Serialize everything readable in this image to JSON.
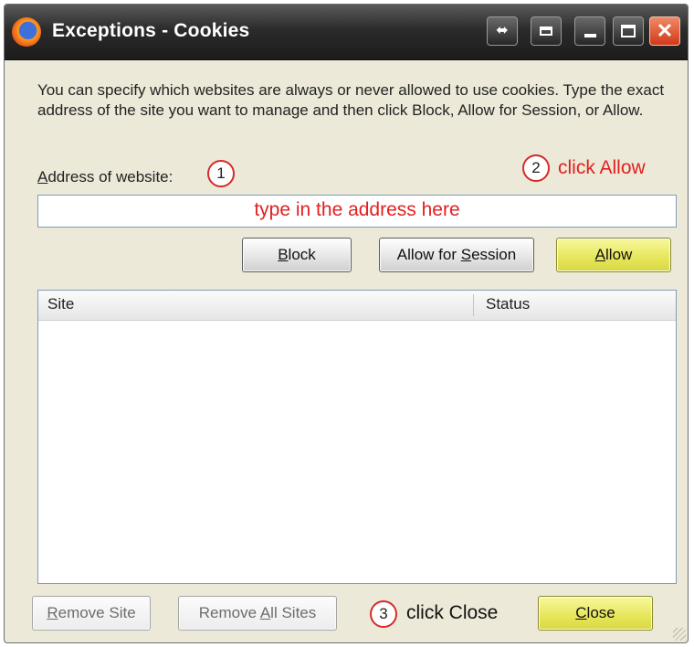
{
  "window": {
    "title": "Exceptions - Cookies",
    "controls": {
      "restore": "⬌",
      "close": "✕"
    }
  },
  "description": "You can specify which websites are always or never allowed to use cookies. Type the exact address of the site you want to manage and then click Block, Allow for Session, or Allow.",
  "address": {
    "label_access_key": "A",
    "label_rest": "ddress of website:",
    "value": "",
    "placeholder_annotation": "type in the address here"
  },
  "buttons": {
    "block": {
      "key": "B",
      "rest": "lock"
    },
    "allow_session": {
      "before": "Allow for ",
      "key": "S",
      "rest": "ession"
    },
    "allow": {
      "key": "A",
      "rest": "llow"
    },
    "remove_site": {
      "key": "R",
      "rest": "emove Site"
    },
    "remove_all": {
      "before": "Remove ",
      "key": "A",
      "rest": "ll Sites"
    },
    "close": {
      "key": "C",
      "rest": "lose"
    }
  },
  "table": {
    "columns": [
      "Site",
      "Status"
    ],
    "rows": []
  },
  "annotations": {
    "step1": "1",
    "step2": "2",
    "step2_text": "click Allow",
    "step3": "3",
    "step3_text": "click Close"
  },
  "colors": {
    "annotation_red": "#e31f1f",
    "highlight_button": "#e6e65a"
  }
}
